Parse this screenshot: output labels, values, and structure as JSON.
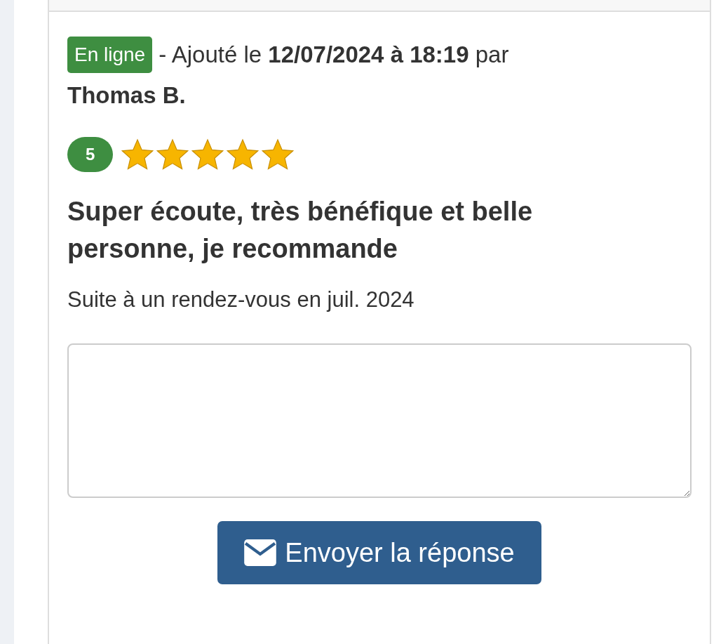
{
  "review": {
    "status_badge": "En ligne",
    "added_text": "- Ajouté le **12/07/2024 à 18:19** par",
    "author": "Thomas B.",
    "rating": {
      "score": "5",
      "stars": 5
    },
    "title": "Super écoute, très bénéfique et belle personne, je recommande",
    "context": "Suite à un rendez-vous en juil. 2024"
  },
  "reply_form": {
    "button": "Envoyer la réponse"
  }
}
